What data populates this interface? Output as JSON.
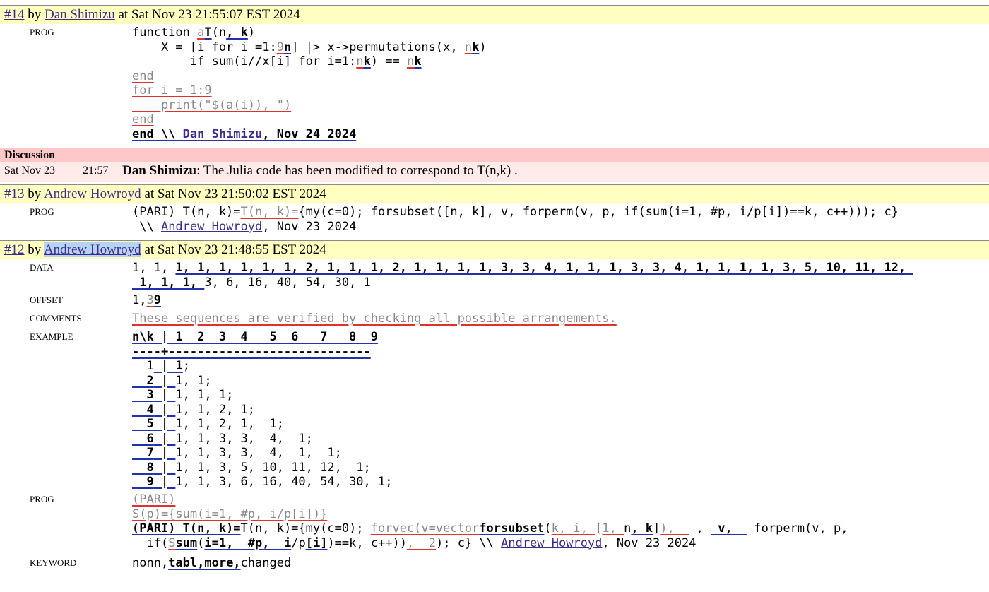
{
  "rev14": {
    "num": "#14",
    "by": "by",
    "author": "Dan Shimizu",
    "at": "at Sat Nov 23 21:55:07 EST 2024",
    "prog_label": "PROG",
    "prog": {
      "l1a": "function ",
      "l1del": "a",
      "l1ins": "T",
      "l1b": "(n",
      "l1ins2": ", k",
      "l1c": ")",
      "l2a": "    X = [i for i =1:",
      "l2del": "9",
      "l2ins": "n",
      "l2b": "] |> x->permutations(x, ",
      "l2del2": "n",
      "l2ins2": "k",
      "l2c": ")",
      "l3a": "        if sum(i//x[i] for i=1:",
      "l3del": "n",
      "l3ins": "k",
      "l3b": ") == ",
      "l3del2": "n",
      "l3ins2": "k",
      "l4": "end",
      "l5": "for i = 1:9",
      "l6": "    print(\"$(a(i)), \")",
      "l7": "end",
      "l8a": "end \\\\ ",
      "l8author": "Dan Shimizu",
      "l8b": ", Nov 24 2024"
    }
  },
  "discussion": {
    "header": "Discussion",
    "date": "Sat Nov 23",
    "time": "21:57",
    "author": "Dan Shimizu",
    "text": ": The Julia code has been modified to correspond to T(n,k) ."
  },
  "rev13": {
    "num": "#13",
    "by": "by",
    "author": "Andrew Howroyd",
    "at": "at Sat Nov 23 21:50:02 EST 2024",
    "prog_label": "PROG",
    "l1a": "(PARI) T(n, k)=",
    "l1del": "T(n, k)=",
    "l1b": "{my(c=0); forsubset([n, k], v, forperm(v, p, if(sum(i=1, #p, i/p[i])==k, c++))); c}",
    "l2a": " \\\\ ",
    "l2author": "Andrew Howroyd",
    "l2b": ", Nov 23 2024"
  },
  "rev12": {
    "num": "#12",
    "by": "by",
    "author": "Andrew Howroyd",
    "at": "at Sat Nov 23 21:48:55 EST 2024",
    "data_label": "DATA",
    "data_l1a": "1, 1, ",
    "data_l1ins": "1, 1, 1, 1, 1, 1, 2, 1, 1, 1, 2, 1, 1, 1, 1, 3, 3, 4, 1, 1, 1, 3, 3, 4, 1, 1, 1, 1, 3, 5, 10, 11, 12, ",
    "data_l2ins": " 1, 1, 1, ",
    "data_l2b": "3, 6, 16, 40, 54, 30, 1",
    "offset_label": "OFFSET",
    "offset_a": "1,",
    "offset_del": "3",
    "offset_ins": "9",
    "comments_label": "COMMENTS",
    "comments": "These sequences are verified by checking all possible arrangements.",
    "example_label": "EXAMPLE",
    "ex_header": "n\\k | 1  2  3  4   5  6   7   8  9",
    "ex_rule": "----+----------------------------",
    "ex_rows": [
      {
        "n": "  1",
        "bar": " | ",
        "vals": "",
        "vals_ins": "1",
        "tail": ";"
      },
      {
        "n": "  2",
        "bar": " | ",
        "vals": "1, 1;",
        "vals_ins": "",
        "tail": ""
      },
      {
        "n": "  3",
        "bar": " | ",
        "vals": "1, 1, 1;",
        "vals_ins": "",
        "tail": ""
      },
      {
        "n": "  4",
        "bar": " | ",
        "vals": "1, 1, 2, 1;",
        "vals_ins": "",
        "tail": ""
      },
      {
        "n": "  5",
        "bar": " | ",
        "vals": "1, 1, 2, 1,  1;",
        "vals_ins": "",
        "tail": ""
      },
      {
        "n": "  6",
        "bar": " | ",
        "vals": "1, 1, 3, 3,  4,  1;",
        "vals_ins": "",
        "tail": ""
      },
      {
        "n": "  7",
        "bar": " | ",
        "vals": "1, 1, 3, 3,  4,  1,  1;",
        "vals_ins": "",
        "tail": ""
      },
      {
        "n": "  8",
        "bar": " | ",
        "vals": "1, 1, 3, 5, 10, 11, 12,  1;",
        "vals_ins": "",
        "tail": ""
      },
      {
        "n": "  9",
        "bar": " | ",
        "vals": "1, 1, 3, 6, 16, 40, 54, 30, 1;",
        "vals_ins": "",
        "tail": ""
      }
    ],
    "prog_label": "PROG",
    "prog_l1del": "(PARI)",
    "prog_l2del": "S(p)={sum(i=1, #p, i/p[i])}",
    "prog_l3ins": "(PARI) T(n, k)=",
    "prog_l3a": "T(n, k)={my(c=0); ",
    "prog_l3del": "forvec(v=vector",
    "prog_l3ins2": "forsubset",
    "prog_l3b": "(",
    "prog_l3del2": "k, i, ",
    "prog_l3c": "[",
    "prog_l3del3": "1, ",
    "prog_l3d": "n",
    "prog_l3ins3": ", k",
    "prog_l3e": "]",
    "prog_l3del4": "),  ",
    "prog_l3f": " , ",
    "prog_l3ins4": " v,  ",
    "prog_l3g": " forperm(v, p,",
    "prog_l4a": "  if(",
    "prog_l4del": "S",
    "prog_l4ins": "sum",
    "prog_l4b": "(",
    "prog_l4ins2": "i=1,  #p,  i",
    "prog_l4c": "/p",
    "prog_l4ins3": "[i]",
    "prog_l4d": ")==k, c++))",
    "prog_l4del2": ",  2",
    "prog_l4e": "); c} \\\\ ",
    "prog_l4author": "Andrew Howroyd",
    "prog_l4f": ", Nov 23 2024",
    "keyword_label": "KEYWORD",
    "kw_a": "nonn,",
    "kw_ins": "tabl,more,",
    "kw_b": "changed"
  }
}
